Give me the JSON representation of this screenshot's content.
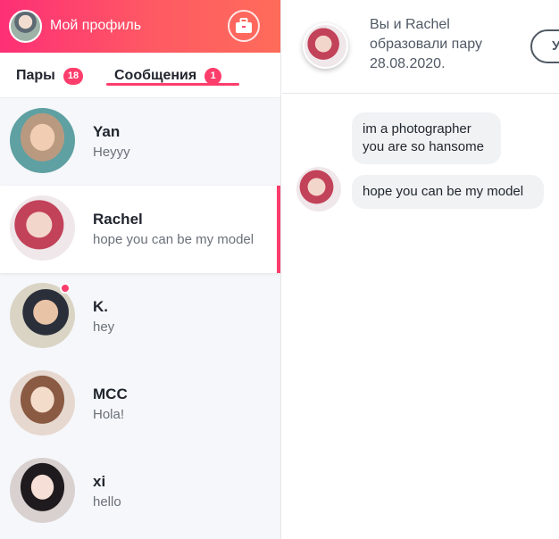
{
  "sidebar": {
    "profile_title": "Мой профиль",
    "tabs": [
      {
        "label": "Пары",
        "badge": "18"
      },
      {
        "label": "Сообщения",
        "badge": "1"
      }
    ],
    "conversations": [
      {
        "name": "Yan",
        "preview": "Heyyy"
      },
      {
        "name": "Rachel",
        "preview": "hope you can be my model"
      },
      {
        "name": "K.",
        "preview": "hey"
      },
      {
        "name": "MCC",
        "preview": "Hola!"
      },
      {
        "name": "xi",
        "preview": "hello"
      }
    ]
  },
  "chat": {
    "match_text": "Вы и Rachel образовали пару 28.08.2020.",
    "header_button": "У",
    "messages": [
      "im a photographer you are so hansome",
      "hope you can be my model"
    ]
  },
  "colors": {
    "accent": "#fd3d6b",
    "header_gradient_start": "#fd2f76",
    "header_gradient_end": "#ff6c5a"
  },
  "icons": {
    "header": "briefcase-icon"
  }
}
